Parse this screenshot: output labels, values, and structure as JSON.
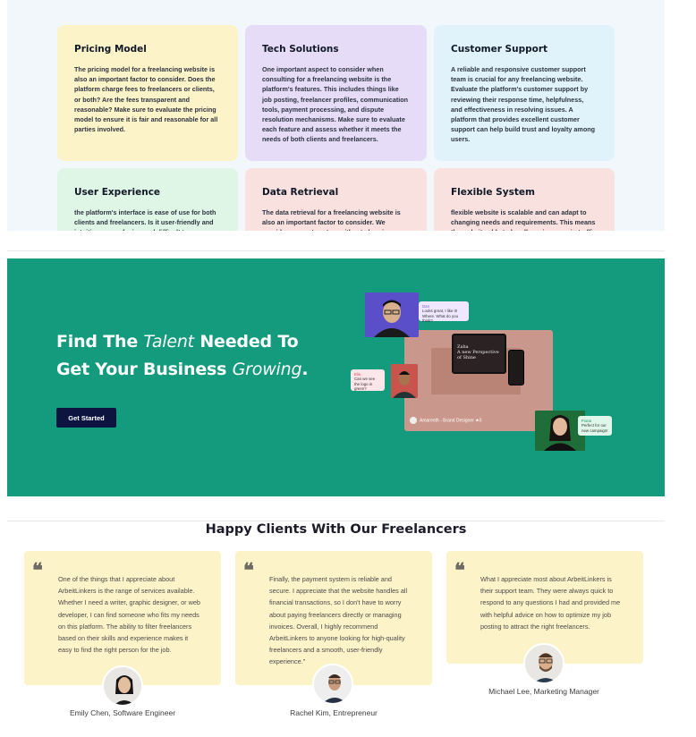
{
  "features": [
    {
      "title": "Pricing Model",
      "text": "The pricing model for a freelancing website is also an important factor to consider. Does the platform charge fees to freelancers or clients, or both? Are the fees transparent and reasonable? Make sure to evaluate the pricing model to ensure it is fair and reasonable for all parties involved.",
      "bg": "#fdf3c9"
    },
    {
      "title": "Tech Solutions",
      "text": "One important aspect to consider when consulting for a freelancing website is the platform's features. This includes things like job posting, freelancer profiles, communication tools, payment processing, and dispute resolution mechanisms. Make sure to evaluate each feature and assess whether it meets the needs of both clients and freelancers.",
      "bg": "#e6dcf8"
    },
    {
      "title": "Customer Support",
      "text": "A reliable and responsive customer support team is crucial for any freelancing website. Evaluate the platform's customer support by reviewing their response time, helpfulness, and effectiveness in resolving issues. A platform that provides excellent customer support can help build trust and loyalty among users.",
      "bg": "#e0f3fb"
    },
    {
      "title": "User Experience",
      "text": "the platform's interface is ease of use for both clients and freelancers. Is it user-friendly and intuitive, or confusing and difficult to navigate? A",
      "bg": "#dff5e6"
    },
    {
      "title": "Data Retrieval",
      "text": "The data retrieval for a freelancing website is also an important factor to consider. We provide payment system without charging",
      "bg": "#f8e1de"
    },
    {
      "title": "Flexible System",
      "text": "flexible website is scalable and can adapt to changing needs and requirements. This means the website able to handle an increase in traffic or",
      "bg": "#f8e1de"
    }
  ],
  "hero": {
    "line1_a": "Find The ",
    "line1_b": "Talent",
    "line1_c": " Needed To",
    "line2_a": "Get Your Business ",
    "line2_b": "Growing",
    "line2_c": ".",
    "button": "Get Started",
    "bubble1_name": "Dan",
    "bubble1_text": "Looks great, I like it! Where. What do you think?",
    "bubble2_name": "Elis",
    "bubble2_text": "Can we see the logo in green?",
    "bubble3_name": "Fiona",
    "bubble3_text": "Perfect for our new campaign!",
    "laptop_brand": "Zaha",
    "laptop_text": "A new Perspective of Shine",
    "mock_caption": "Amarenth - Brand Designer",
    "mock_rating": "★5"
  },
  "testimonials": {
    "title": "Happy Clients With Our Freelancers",
    "items": [
      {
        "quote": "One of the things that I appreciate about ArbeitLinkers is the range of services available. Whether I need a writer, graphic designer, or web developer, I can find someone who fits my needs on this platform. The ability to filter freelancers based on their skills and experience makes it easy to find the right person for the job.",
        "name": "Emily Chen, Software Engineer"
      },
      {
        "quote": "Finally, the payment system is reliable and secure. I appreciate that the website handles all financial transactions, so I don't have to worry about paying freelancers directly or managing invoices. Overall, I highly recommend ArbeitLinkers to anyone looking for high-quality freelancers and a smooth, user-friendly experience.\"",
        "name": "Rachel Kim, Entrepreneur"
      },
      {
        "quote": "What I appreciate most about ArbeitLinkers is their support team. They were always quick to respond to any questions I had and provided me with helpful advice on how to optimize my job posting to attract the right freelancers.",
        "name": "Michael Lee, Marketing Manager"
      }
    ],
    "quote_mark": "❝"
  },
  "colors": {
    "hero_bg": "#149a7c",
    "button_bg": "#0d1440",
    "testimonial_bg": "#fdf3c9"
  }
}
